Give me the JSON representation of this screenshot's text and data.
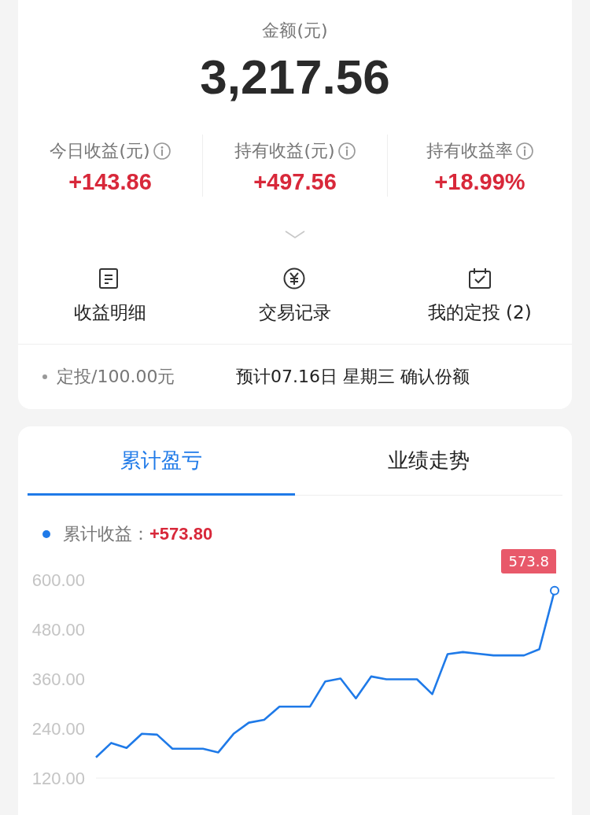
{
  "summary": {
    "amount_label": "金额(元)",
    "amount": "3,217.56",
    "stats": [
      {
        "label": "今日收益(元)",
        "value": "+143.86"
      },
      {
        "label": "持有收益(元)",
        "value": "+497.56"
      },
      {
        "label": "持有收益率",
        "value": "+18.99%"
      }
    ],
    "actions": [
      {
        "kind": "document",
        "label": "收益明细"
      },
      {
        "kind": "yuan",
        "label": "交易记录"
      },
      {
        "kind": "calendar",
        "label": "我的定投 (2)"
      }
    ],
    "plan": {
      "amount": "定投/100.00元",
      "note": "预计07.16日 星期三 确认份额"
    }
  },
  "performance": {
    "tabs": [
      {
        "label": "累计盈亏",
        "selected": true
      },
      {
        "label": "业绩走势",
        "selected": false
      }
    ],
    "legend": {
      "label": "累计收益：",
      "value": "+573.80",
      "color": "#1f7ae8"
    },
    "chart_data": {
      "type": "line",
      "ylim": [
        120,
        600
      ],
      "yticks": [
        {
          "value": 600,
          "label": "600.00"
        },
        {
          "value": 480,
          "label": "480.00"
        },
        {
          "value": 360,
          "label": "360.00"
        },
        {
          "value": 240,
          "label": "240.00"
        },
        {
          "value": 120,
          "label": "120.00"
        }
      ],
      "series": [
        {
          "color": "#1f7ae8",
          "values": [
            170,
            205,
            193,
            227,
            225,
            191,
            191,
            191,
            182,
            227,
            254,
            261,
            293,
            293,
            293,
            354,
            361,
            313,
            366,
            359,
            359,
            359,
            323,
            420,
            425,
            421,
            417,
            417,
            417,
            432,
            574
          ]
        }
      ],
      "annotations": [
        {
          "text": "573.8"
        }
      ]
    }
  }
}
